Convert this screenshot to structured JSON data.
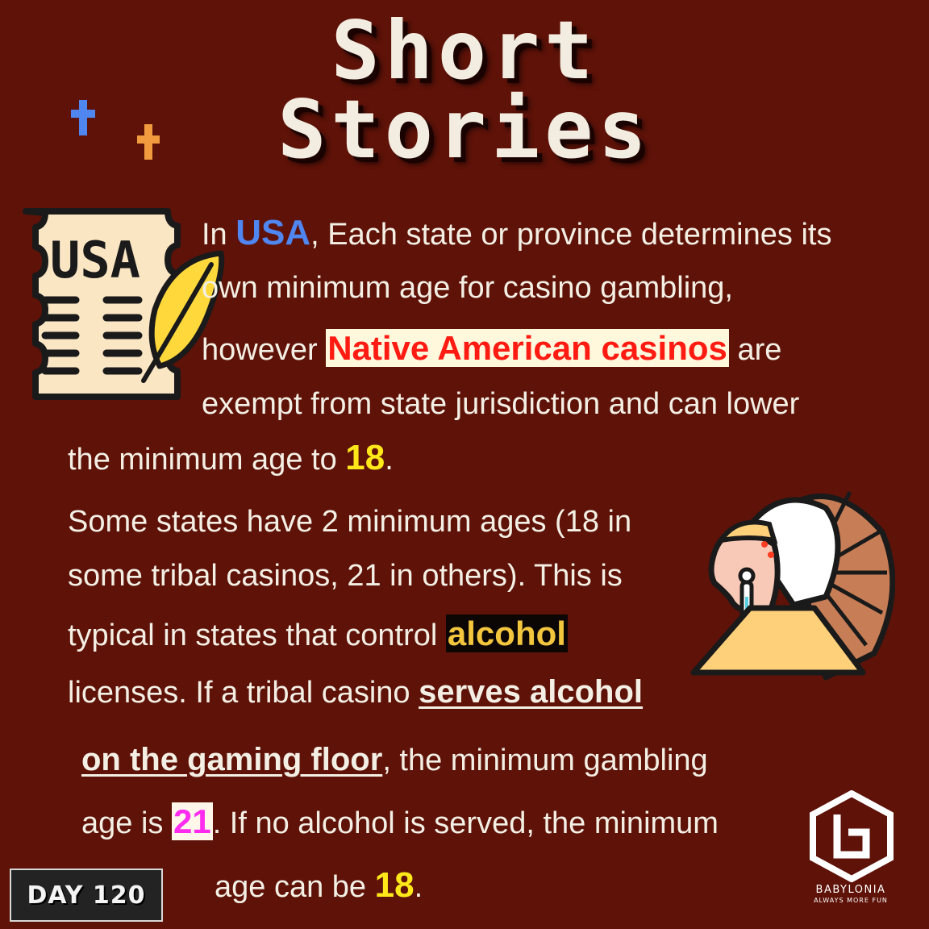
{
  "title": {
    "line1": "Short",
    "line2": "Stories"
  },
  "paragraph1": {
    "l1_pre": "In ",
    "l1_usa": "USA",
    "l1_post": ", Each state or province determines its",
    "l2": "own minimum age for casino gambling,",
    "l3_pre": "however ",
    "l3_hl": "Native American casinos",
    "l3_post": " are",
    "l4": "exempt from state jurisdiction and can lower",
    "l5_pre": "the minimum age to ",
    "l5_num": "18",
    "l5_post": "."
  },
  "paragraph2": {
    "l1": "Some states have 2 minimum ages (18 in",
    "l2": "some tribal casinos, 21 in others). This is",
    "l3_pre": "typical in states that control ",
    "l3_hl": "alcohol",
    "l4_pre": "licenses. If a tribal casino ",
    "l4_ul": "serves alcohol",
    "l5_ul": "on the gaming floor",
    "l5_post": ", the minimum gambling",
    "l6_pre": "age is ",
    "l6_num": "21",
    "l6_post": ". If no alcohol is served, the minimum",
    "l7_pre": "age can be ",
    "l7_num": "18",
    "l7_post": "."
  },
  "newspaper": {
    "label": "USA"
  },
  "badge": {
    "label": "DAY 120"
  },
  "brand": {
    "name": "BABYLONIA",
    "tagline": "ALWAYS MORE FUN"
  },
  "colors": {
    "background": "#5e1208",
    "usa": "#4f86f0",
    "native": "#ff1a12",
    "number18": "#ffe81a",
    "alcohol": "#f3c63e",
    "number21": "#ff2cf0"
  }
}
